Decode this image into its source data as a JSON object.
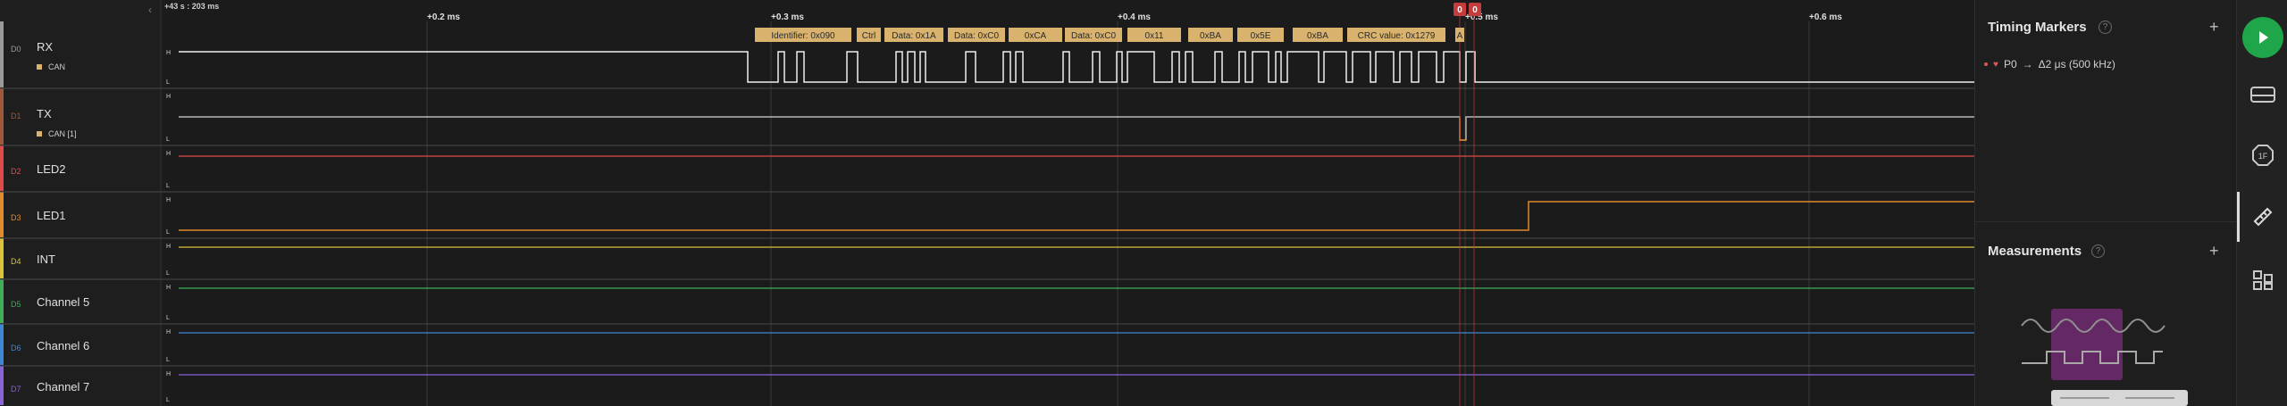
{
  "timeline": {
    "left_label": "+43 s : 203 ms",
    "ticks": [
      "+0.2 ms",
      "+0.3 ms",
      "+0.4 ms",
      "+0.5 ms",
      "+0.6 ms"
    ]
  },
  "channels": [
    {
      "id": "D0",
      "name": "RX",
      "analyzer": "CAN",
      "color": "#9a9a9a"
    },
    {
      "id": "D1",
      "name": "TX",
      "analyzer": "CAN [1]",
      "color": "#a0583b"
    },
    {
      "id": "D2",
      "name": "LED2",
      "analyzer": "",
      "color": "#e04a4a"
    },
    {
      "id": "D3",
      "name": "LED1",
      "analyzer": "",
      "color": "#e08a2c"
    },
    {
      "id": "D4",
      "name": "INT",
      "analyzer": "",
      "color": "#d9c33a"
    },
    {
      "id": "D5",
      "name": "Channel 5",
      "analyzer": "",
      "color": "#3fae58"
    },
    {
      "id": "D6",
      "name": "Channel 6",
      "analyzer": "",
      "color": "#3e86d6"
    },
    {
      "id": "D7",
      "name": "Channel 7",
      "analyzer": "",
      "color": "#8a63d6"
    }
  ],
  "level_labels": {
    "high": "H",
    "low": "L"
  },
  "decode_labels": [
    "Identifier: 0x090",
    "Ctrl",
    "Data: 0x1A",
    "Data: 0xC0",
    "0xCA",
    "Data: 0xC0",
    "0x11",
    "0xBA",
    "0x5E",
    "0xBA",
    "CRC value: 0x1279",
    "A"
  ],
  "marker_flags": [
    "0",
    "0"
  ],
  "timing_markers": {
    "title": "Timing Markers",
    "help": "?",
    "add": "+",
    "items": [
      {
        "name": "P0",
        "arrow": "→",
        "value": "Δ2 μs (500 kHz)"
      }
    ]
  },
  "measurements": {
    "title": "Measurements",
    "help": "?",
    "add": "+"
  },
  "rail": {
    "icons": [
      "play-icon",
      "analyzers-icon",
      "extensions-icon",
      "timing-markers-icon",
      "measurements-icon"
    ]
  },
  "colors": {
    "decode_bubble": "#d9b36d",
    "marker_red": "#c43c3c",
    "play_green": "#1fa64a",
    "measure_purple": "#6b2a6b"
  }
}
